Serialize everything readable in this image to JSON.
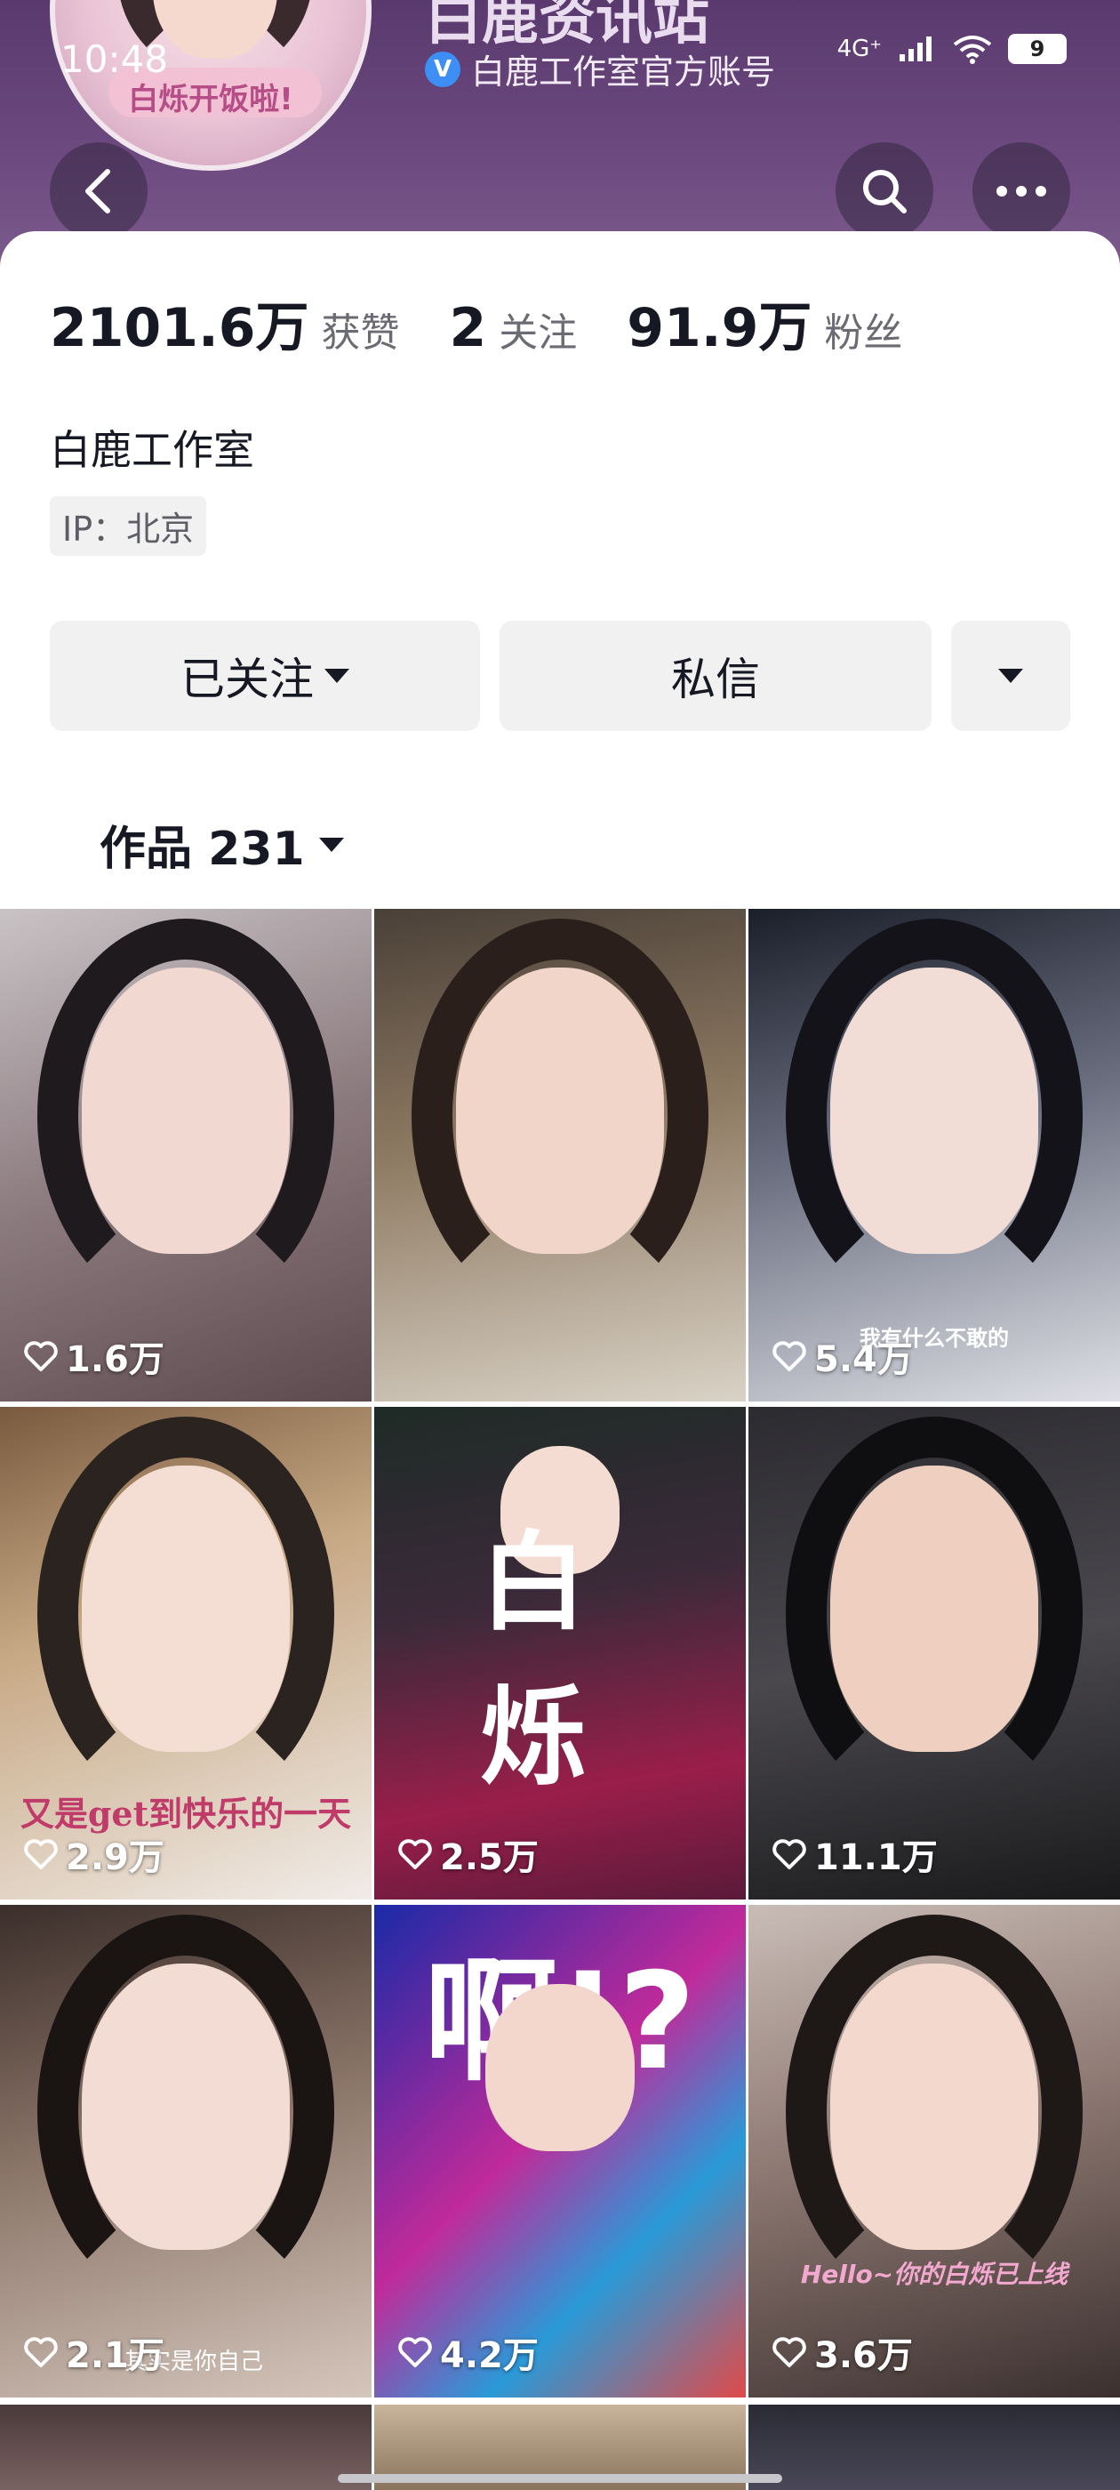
{
  "status_bar": {
    "time": "10:48",
    "signal": "4G⁺",
    "battery": "9"
  },
  "profile": {
    "name": "白鹿资讯站",
    "avatar_text": "白烁开饭啦!",
    "verify_text": "白鹿工作室官方账号",
    "stats": [
      {
        "value": "2101.6万",
        "label": "获赞"
      },
      {
        "value": "2",
        "label": "关注"
      },
      {
        "value": "91.9万",
        "label": "粉丝"
      }
    ],
    "bio_name": "白鹿工作室",
    "ip": "IP：北京"
  },
  "actions": {
    "follow": "已关注",
    "message": "私信"
  },
  "tab": {
    "label": "作品 231"
  },
  "colors": {
    "accent": "#3d8ef5",
    "header": "#6d4a80",
    "button_bg": "#f1f1f2"
  },
  "icons": {
    "back": "chevron-left-icon",
    "search": "search-icon",
    "more": "more-icon",
    "heart": "heart-icon"
  },
  "videos": [
    {
      "likes": "1.6万",
      "overlay": ""
    },
    {
      "likes": "",
      "overlay": ""
    },
    {
      "likes": "5.4万",
      "overlay": "我有什么不敢的"
    },
    {
      "likes": "2.9万",
      "overlay": "又是get到快乐的一天"
    },
    {
      "likes": "2.5万",
      "overlay": "白 烁"
    },
    {
      "likes": "11.1万",
      "overlay": ""
    },
    {
      "likes": "2.1万",
      "overlay": "其实是你自己"
    },
    {
      "likes": "4.2万",
      "overlay": "啊!?"
    },
    {
      "likes": "3.6万",
      "overlay": "Hello~你的白烁已上线"
    }
  ]
}
